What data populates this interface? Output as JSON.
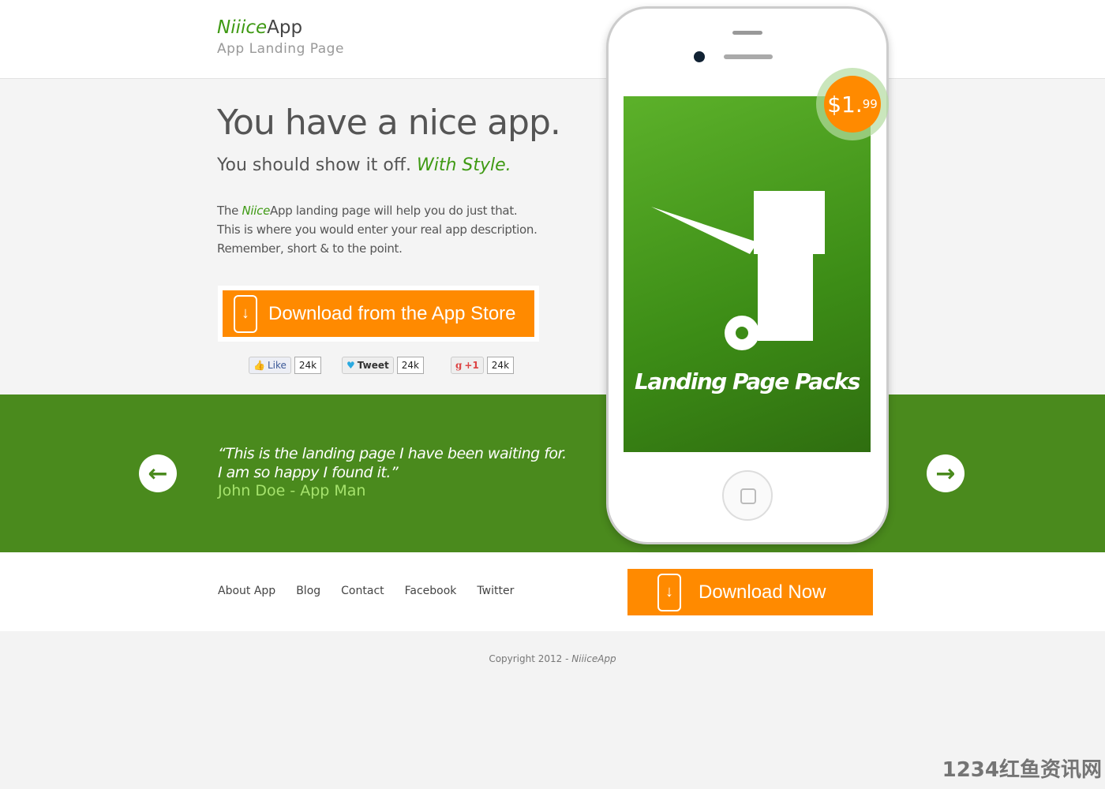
{
  "header": {
    "logo_brand": "Niiice",
    "logo_app": "App",
    "tagline": "App Landing Page"
  },
  "hero": {
    "title": "You have a nice app.",
    "subtitle": "You should show it off.",
    "subtitle_accent": "With Style.",
    "desc_pre": "The ",
    "desc_brand": "Niice",
    "desc_line1": "App landing page will help you do just that.",
    "desc_line2": "This is where you would enter your real app description.",
    "desc_line3": "Remember, short & to the point.",
    "cta_label": "Download from the App Store"
  },
  "social": [
    {
      "label": "Like",
      "count": "24k"
    },
    {
      "label": "Tweet",
      "count": "24k"
    },
    {
      "label": "+1",
      "count": "24k"
    }
  ],
  "testimonial": {
    "line1": "“This is the landing page I have been waiting for.",
    "line2": "I am so happy I found it.”",
    "author": "John Doe - App Man"
  },
  "phone": {
    "screen_text": "Landing Page Packs",
    "price_main": "$1.",
    "price_cents": "99"
  },
  "nav": [
    "About App",
    "Blog",
    "Contact",
    "Facebook",
    "Twitter"
  ],
  "download_now": "Download Now",
  "footer": {
    "copyright": "Copyright 2012 - ",
    "brand": "NiiiceApp"
  },
  "watermark": "1234红鱼资讯网",
  "colors": {
    "green": "#4a8a1d",
    "accent": "#ff8a00",
    "brand_green": "#3f9a14"
  }
}
